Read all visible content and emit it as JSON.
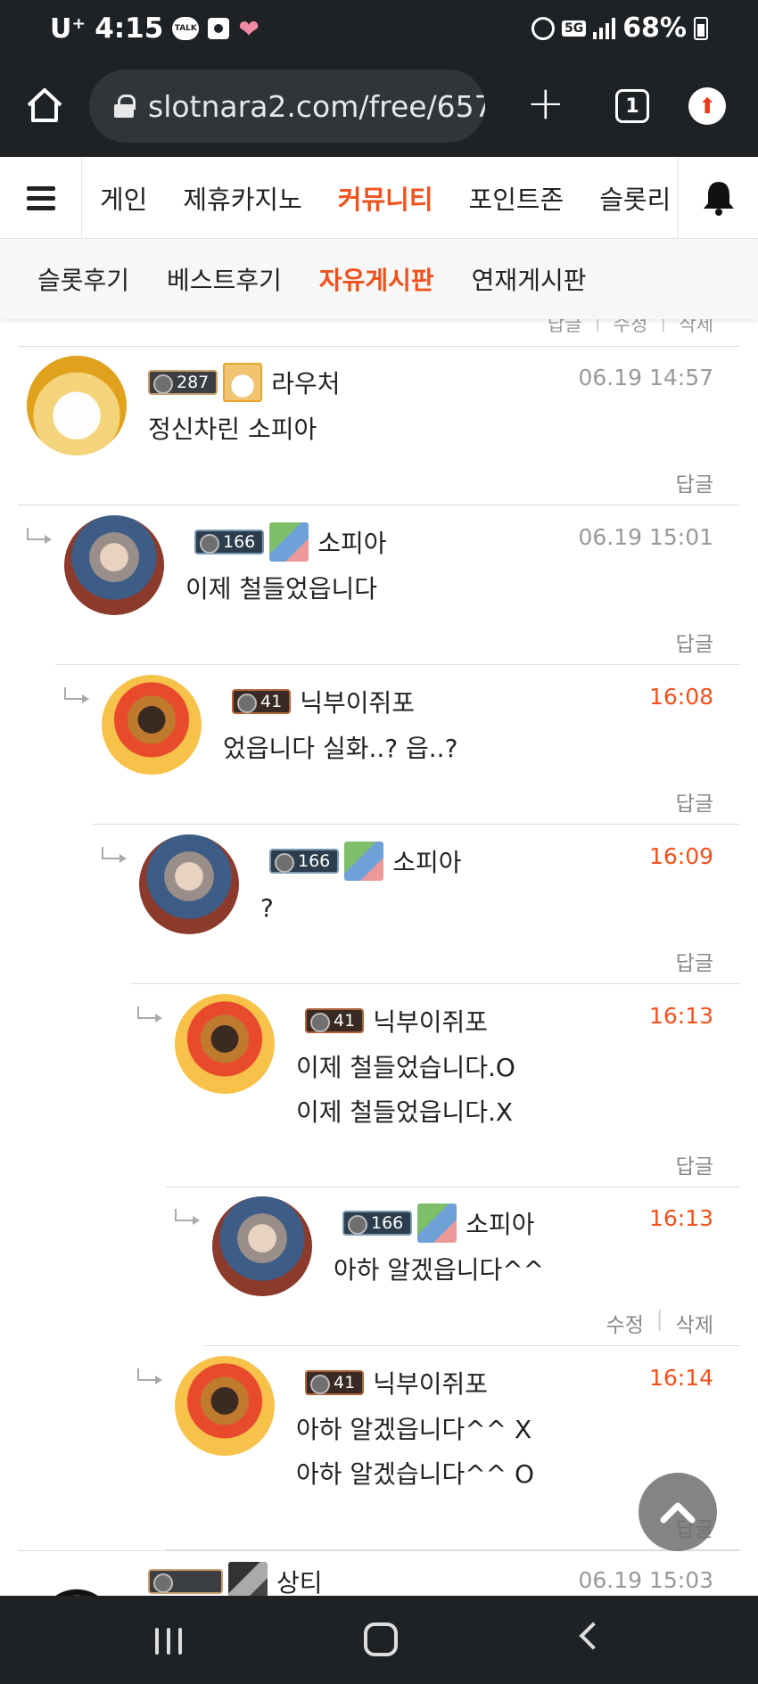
{
  "status_bar": {
    "carrier": "U⁺",
    "time": "4:15",
    "talk_label": "TALK",
    "network": "5G",
    "battery": "68%"
  },
  "browser": {
    "url": "slotnara2.com/free/657",
    "tab_count": "1"
  },
  "site_nav": {
    "items": [
      {
        "label": "게인"
      },
      {
        "label": "제휴카지노"
      },
      {
        "label": "커뮤니티"
      },
      {
        "label": "포인트존"
      },
      {
        "label": "슬롯리"
      }
    ],
    "active": "커뮤니티"
  },
  "sub_nav": {
    "items": [
      {
        "label": "슬롯후기"
      },
      {
        "label": "베스트후기"
      },
      {
        "label": "자유게시판"
      },
      {
        "label": "연재게시판"
      }
    ],
    "active": "자유게시판"
  },
  "cutoff_actions": {
    "reply": "답글",
    "edit": "수정",
    "delete": "삭제"
  },
  "comments": [
    {
      "level": "287",
      "nickname": "라우처",
      "time": "06.19 14:57",
      "lines": [
        "정신차린 소피아"
      ],
      "reply": "답글"
    },
    {
      "level": "166",
      "nickname": "소피아",
      "time": "06.19 15:01",
      "lines": [
        "이제 철들었읍니다"
      ],
      "reply": "답글"
    },
    {
      "level": "41",
      "nickname": "닉부이쥐포",
      "time": "16:08",
      "lines": [
        "었읍니다 실화..? 읍..?"
      ],
      "reply": "답글"
    },
    {
      "level": "166",
      "nickname": "소피아",
      "time": "16:09",
      "lines": [
        "?"
      ],
      "reply": "답글"
    },
    {
      "level": "41",
      "nickname": "닉부이쥐포",
      "time": "16:13",
      "lines": [
        "이제 철들었습니다.O",
        "이제 철들었읍니다.X"
      ],
      "reply": "답글"
    },
    {
      "level": "166",
      "nickname": "소피아",
      "time": "16:13",
      "lines": [
        "아하 알겠읍니다^^"
      ],
      "edit": "수정",
      "delete": "삭제"
    },
    {
      "level": "41",
      "nickname": "닉부이쥐포",
      "time": "16:14",
      "lines": [
        "아하 알겠읍니다^^ X",
        "아하 알겠습니다^^ O"
      ],
      "reply": "답글"
    },
    {
      "level": "",
      "nickname": "상티",
      "time": "06.19 15:03",
      "lines": []
    }
  ],
  "colors": {
    "accent": "#f0521e",
    "dark_bar": "#1e2225"
  },
  "icons": [
    "home-icon",
    "lock-icon",
    "plus-icon",
    "tabs-icon",
    "update-icon",
    "hamburger-icon",
    "bell-icon",
    "reply-arrow-icon",
    "chevron-up-icon"
  ]
}
